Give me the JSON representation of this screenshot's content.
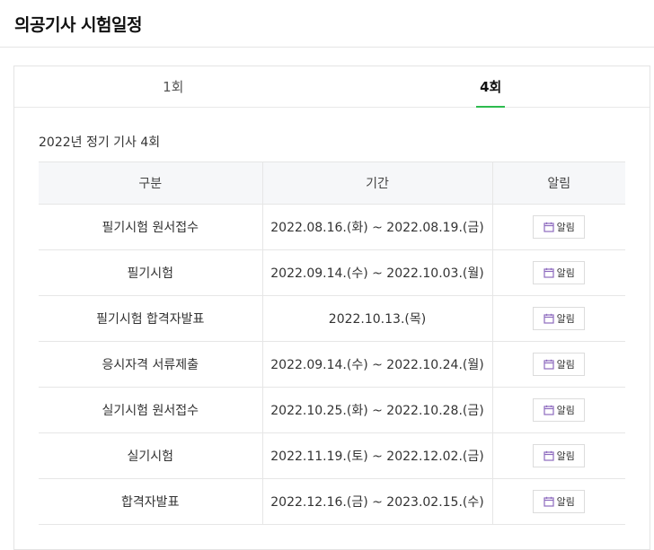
{
  "page": {
    "title": "의공기사 시험일정"
  },
  "tabs": [
    {
      "label": "1회",
      "active": false
    },
    {
      "label": "4회",
      "active": true
    }
  ],
  "schedule": {
    "subtitle": "2022년 정기 기사 4회",
    "columns": [
      "구분",
      "기간",
      "알림"
    ],
    "alarm_label": "알림",
    "alarm_icon": "calendar-icon",
    "rows": [
      {
        "category": "필기시험 원서접수",
        "period": "2022.08.16.(화) ~ 2022.08.19.(금)"
      },
      {
        "category": "필기시험",
        "period": "2022.09.14.(수) ~ 2022.10.03.(월)"
      },
      {
        "category": "필기시험 합격자발표",
        "period": "2022.10.13.(목)"
      },
      {
        "category": "응시자격 서류제출",
        "period": "2022.09.14.(수) ~ 2022.10.24.(월)"
      },
      {
        "category": "실기시험 원서접수",
        "period": "2022.10.25.(화) ~ 2022.10.28.(금)"
      },
      {
        "category": "실기시험",
        "period": "2022.11.19.(토) ~ 2022.12.02.(금)"
      },
      {
        "category": "합격자발표",
        "period": "2022.12.16.(금) ~ 2023.02.15.(수)"
      }
    ]
  },
  "colors": {
    "accent": "#2dbb4e",
    "icon": "#8e6bbf",
    "header_bg": "#f6f7f9"
  }
}
